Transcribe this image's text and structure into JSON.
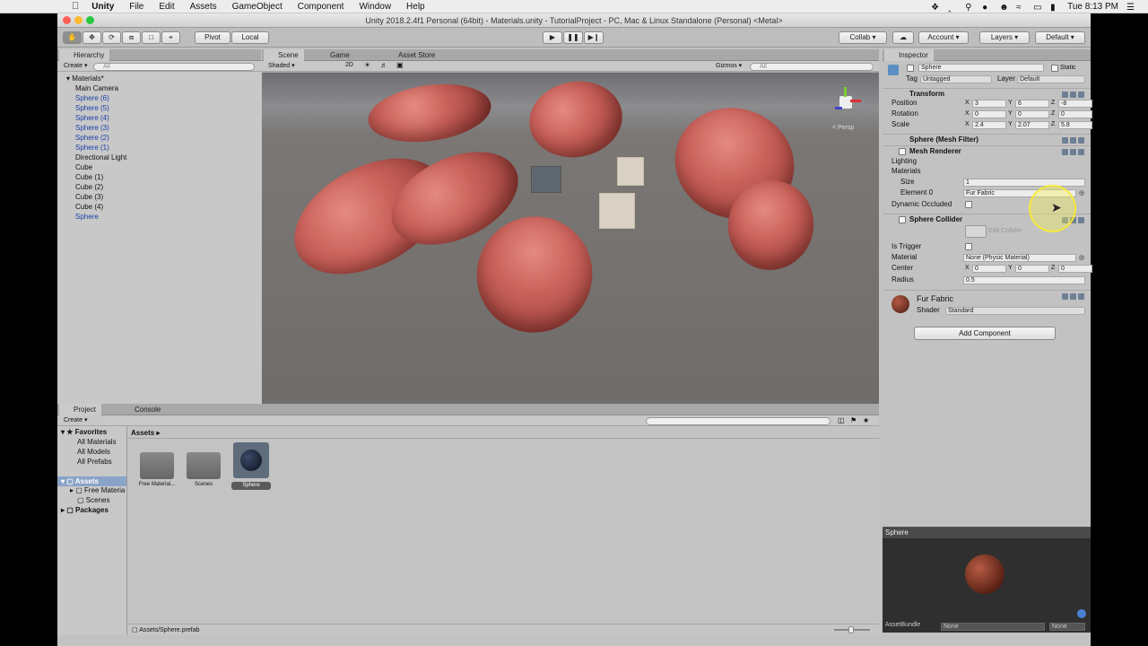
{
  "menubar": {
    "unity": "Unity",
    "items": [
      "File",
      "Edit",
      "Assets",
      "GameObject",
      "Component",
      "Window",
      "Help"
    ],
    "clock": "Tue 8:13 PM"
  },
  "title": "Unity 2018.2.4f1 Personal (64bit) - Materials.unity - TutorialProject - PC, Mac & Linux Standalone (Personal) <Metal>",
  "toolbar": {
    "pivot": "Pivot",
    "local": "Local",
    "collab": "Collab",
    "account": "Account",
    "layers": "Layers",
    "layout": "Default"
  },
  "hierarchy": {
    "tab": "Hierarchy",
    "create": "Create",
    "search": "All",
    "scene": "Materials*",
    "items": [
      {
        "label": "Main Camera",
        "blue": false
      },
      {
        "label": "Sphere (6)",
        "blue": true
      },
      {
        "label": "Sphere (5)",
        "blue": true
      },
      {
        "label": "Sphere (4)",
        "blue": true
      },
      {
        "label": "Sphere (3)",
        "blue": true
      },
      {
        "label": "Sphere (2)",
        "blue": true
      },
      {
        "label": "Sphere (1)",
        "blue": true
      },
      {
        "label": "Directional Light",
        "blue": false
      },
      {
        "label": "Cube",
        "blue": false
      },
      {
        "label": "Cube (1)",
        "blue": false
      },
      {
        "label": "Cube (2)",
        "blue": false
      },
      {
        "label": "Cube (3)",
        "blue": false
      },
      {
        "label": "Cube (4)",
        "blue": false
      },
      {
        "label": "Sphere",
        "blue": true
      }
    ]
  },
  "scene": {
    "tabs": [
      "Scene",
      "Game",
      "Asset Store"
    ],
    "shading": "Shaded",
    "mode2d": "2D",
    "gizmos": "Gizmos",
    "search": "All",
    "persp": "< Persp"
  },
  "project": {
    "tabs": [
      "Project",
      "Console"
    ],
    "create": "Create",
    "favorites": "Favorites",
    "fav_items": [
      "All Materials",
      "All Models",
      "All Prefabs"
    ],
    "assets": "Assets",
    "asset_tree": [
      "Free Materia",
      "Scenes"
    ],
    "packages": "Packages",
    "breadcrumb": "Assets",
    "files": [
      "Free Material...",
      "Scenes",
      "Sphere"
    ],
    "footer_path": "Assets/Sphere.prefab"
  },
  "inspector": {
    "tab": "Inspector",
    "object_name": "Sphere",
    "static": "Static",
    "tag_label": "Tag",
    "tag": "Untagged",
    "layer_label": "Layer",
    "layer": "Default",
    "transform": "Transform",
    "position_label": "Position",
    "rotation_label": "Rotation",
    "scale_label": "Scale",
    "position": {
      "x": "3",
      "y": "6",
      "z": "-8"
    },
    "rotation": {
      "x": "0",
      "y": "0",
      "z": "0"
    },
    "scale": {
      "x": "2.4",
      "y": "2.07",
      "z": "5.8"
    },
    "mesh_filter": "Sphere (Mesh Filter)",
    "mesh_renderer": "Mesh Renderer",
    "lighting": "Lighting",
    "materials": "Materials",
    "size_label": "Size",
    "size": "1",
    "element0_label": "Element 0",
    "element0": "Fur Fabric",
    "dynamic_occluded": "Dynamic Occluded",
    "sphere_collider": "Sphere Collider",
    "edit_collider": "Edit Collider",
    "is_trigger": "Is Trigger",
    "material_label": "Material",
    "material": "None (Physic Material)",
    "center_label": "Center",
    "center": {
      "x": "0",
      "y": "0",
      "z": "0"
    },
    "radius_label": "Radius",
    "radius": "0.5",
    "mat_name": "Fur Fabric",
    "shader_label": "Shader",
    "shader": "Standard",
    "add_component": "Add Component",
    "preview_title": "Sphere",
    "assetbundle": "AssetBundle",
    "bundle_none": "None",
    "variant_none": "None"
  }
}
